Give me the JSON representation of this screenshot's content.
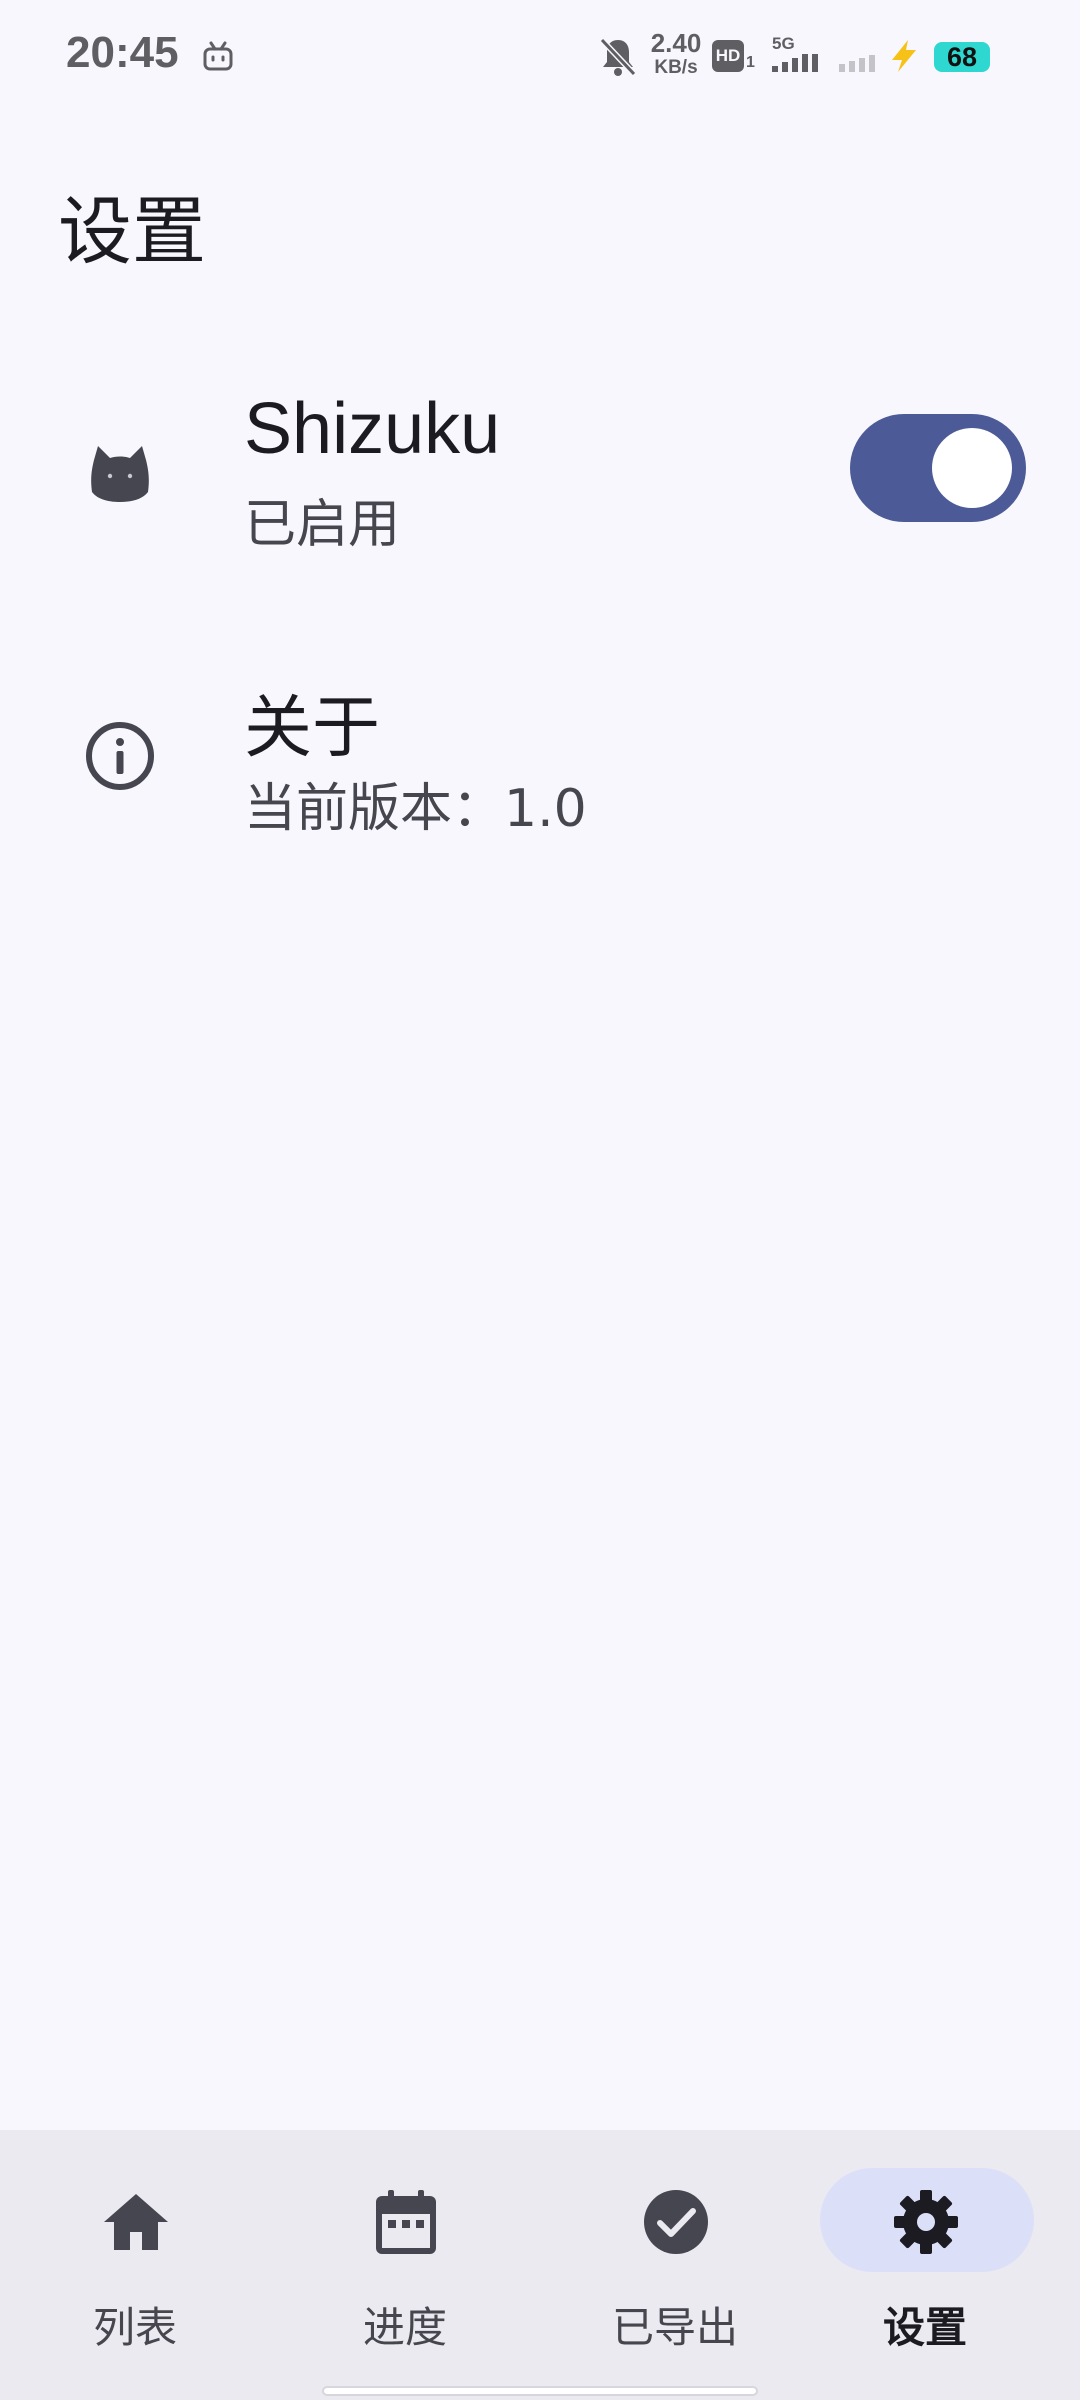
{
  "status_bar": {
    "time": "20:45",
    "net_speed_value": "2.40",
    "net_speed_unit": "KB/s",
    "hd_label": "HD",
    "hd_sub": "1",
    "network_label": "5G",
    "battery": "68",
    "icons": [
      "bilibili-tv-icon",
      "bell-off-icon",
      "hd-icon",
      "signal-5g-icon",
      "signal-weak-icon",
      "charging-bolt-icon",
      "battery-icon"
    ]
  },
  "page": {
    "title": "设置"
  },
  "settings": {
    "shizuku": {
      "title": "Shizuku",
      "subtitle": "已启用",
      "icon": "cat-icon",
      "enabled": true
    },
    "about": {
      "title": "关于",
      "subtitle": "当前版本：1.0",
      "icon": "info-icon"
    }
  },
  "nav": {
    "items": [
      {
        "label": "列表",
        "icon": "home-icon",
        "active": false
      },
      {
        "label": "进度",
        "icon": "calendar-icon",
        "active": false
      },
      {
        "label": "已导出",
        "icon": "check-circle-icon",
        "active": false
      },
      {
        "label": "设置",
        "icon": "gear-icon",
        "active": true
      }
    ]
  },
  "colors": {
    "background": "#f8f7fd",
    "toggle_on": "#4c5b97",
    "nav_bar": "#ebeaf0",
    "nav_active_pill": "#dcdff8",
    "battery": "#2fd7d1"
  }
}
